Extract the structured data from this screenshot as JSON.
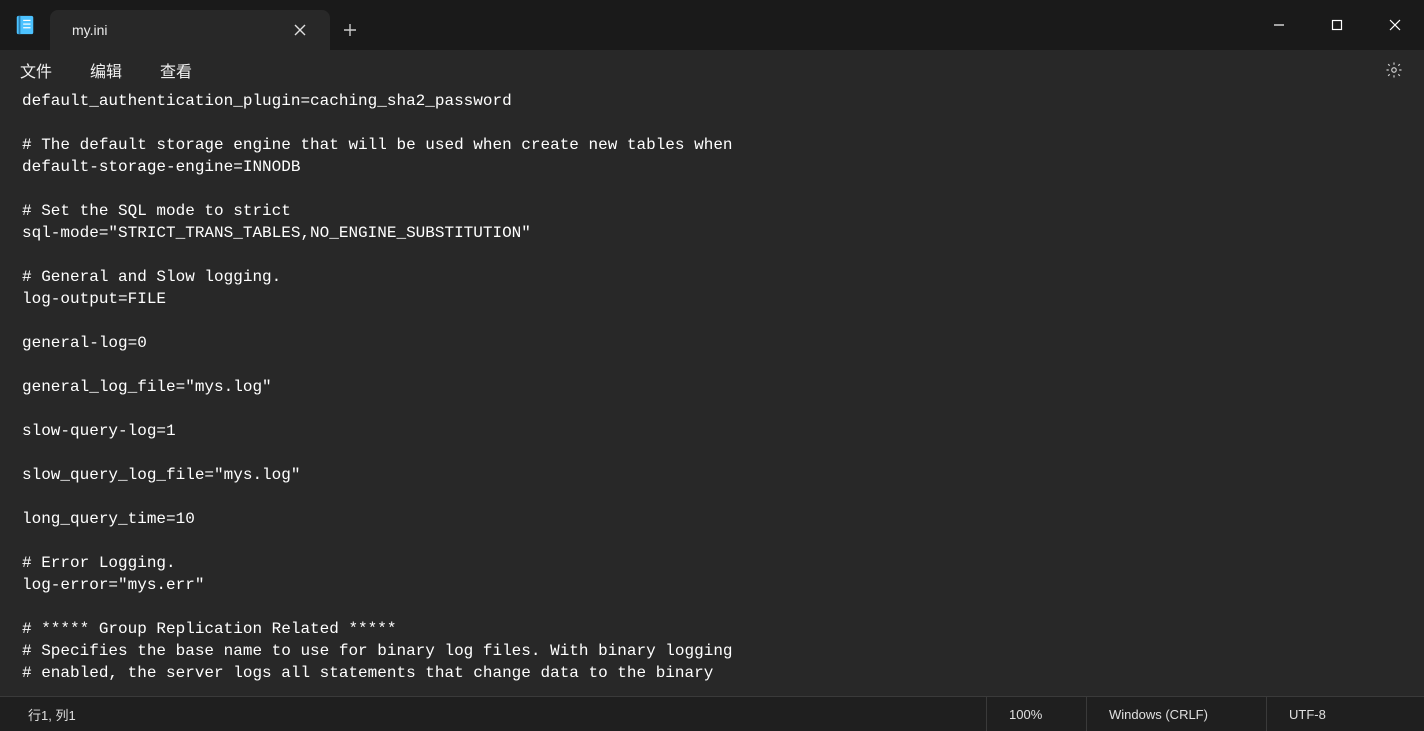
{
  "tab": {
    "title": "my.ini"
  },
  "menu": {
    "file": "文件",
    "edit": "编辑",
    "view": "查看"
  },
  "editor": {
    "lines": [
      "default_authentication_plugin=caching_sha2_password",
      "",
      "# The default storage engine that will be used when create new tables when",
      "default-storage-engine=INNODB",
      "",
      "# Set the SQL mode to strict",
      "sql-mode=\"STRICT_TRANS_TABLES,NO_ENGINE_SUBSTITUTION\"",
      "",
      "# General and Slow logging.",
      "log-output=FILE",
      "",
      "general-log=0",
      "",
      "general_log_file=\"mys.log\"",
      "",
      "slow-query-log=1",
      "",
      "slow_query_log_file=\"mys.log\"",
      "",
      "long_query_time=10",
      "",
      "# Error Logging.",
      "log-error=\"mys.err\"",
      "",
      "# ***** Group Replication Related *****",
      "# Specifies the base name to use for binary log files. With binary logging",
      "# enabled, the server logs all statements that change data to the binary"
    ]
  },
  "status": {
    "position": "行1, 列1",
    "zoom": "100%",
    "line_ending": "Windows (CRLF)",
    "encoding": "UTF-8"
  }
}
